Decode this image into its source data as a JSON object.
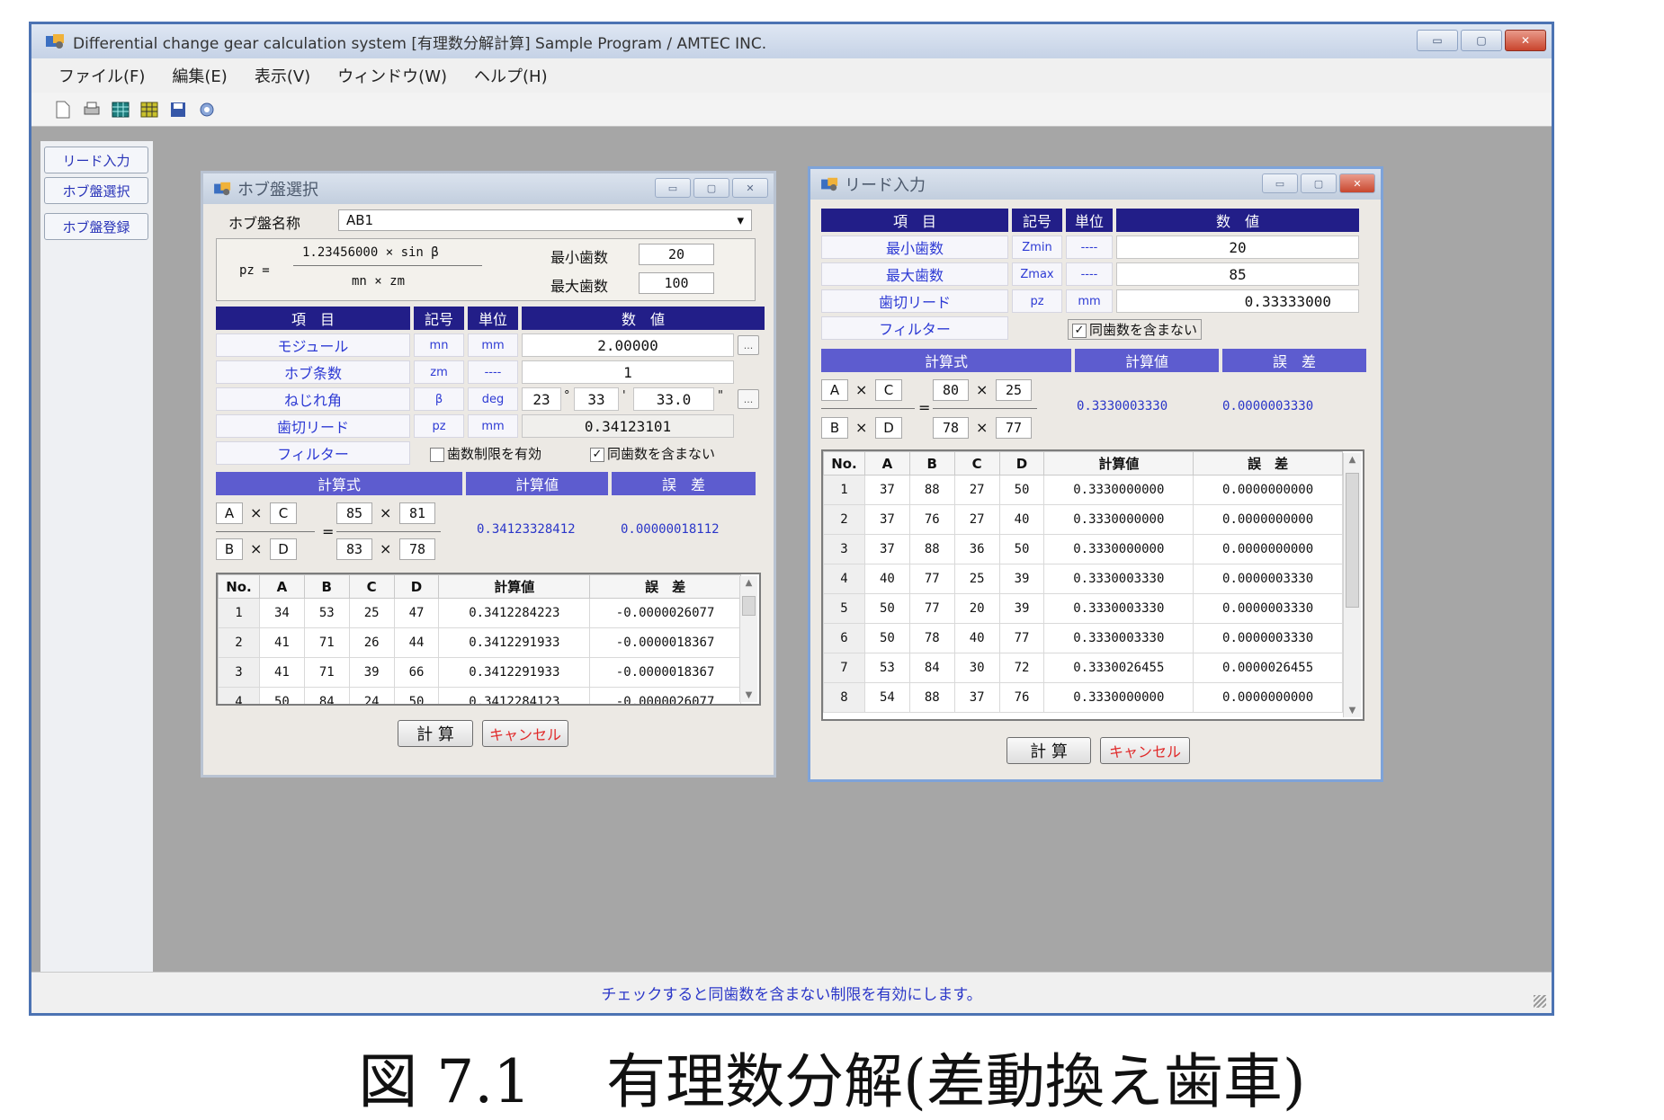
{
  "window": {
    "title": "Differential change gear calculation system [有理数分解計算]  Sample Program / AMTEC INC.",
    "minimize": "▭",
    "maximize": "▢",
    "close": "✕"
  },
  "menu": [
    "ファイル(F)",
    "編集(E)",
    "表示(V)",
    "ウィンドウ(W)",
    "ヘルプ(H)"
  ],
  "toolbar_icons": [
    "new-file-icon",
    "print-icon",
    "grid-icon",
    "table-icon",
    "save-icon",
    "tool-icon"
  ],
  "sidebar": [
    "リード入力",
    "ホブ盤選択",
    "ホブ盤登録"
  ],
  "status": "チェックすると同歯数を含まない制限を有効にします。",
  "caption": "図 7.1    有理数分解(差動換え歯車)",
  "hob": {
    "title": "ホブ盤選択",
    "machine_label": "ホブ盤名称",
    "machine_value": "AB1",
    "dropdown": "▾",
    "formula_pz": "pz =",
    "formula_num": "1.23456000 × sin β",
    "formula_den": "mn × zm",
    "min_label": "最小歯数",
    "min_value": "20",
    "max_label": "最大歯数",
    "max_value": "100",
    "headers": [
      "項　目",
      "記号",
      "単位",
      "数　値"
    ],
    "rows": [
      {
        "label": "モジュール",
        "sym": "mn",
        "unit": "mm",
        "value": "2.00000"
      },
      {
        "label": "ホブ条数",
        "sym": "zm",
        "unit": "----",
        "value": "1"
      },
      {
        "label": "ねじれ角",
        "sym": "β",
        "unit": "deg",
        "v1": "23",
        "v2": "33",
        "v3": "33.0"
      },
      {
        "label": "歯切リード",
        "sym": "pz",
        "unit": "mm",
        "value": "0.34123101"
      },
      {
        "label": "フィルター",
        "chk1": "歯数制限を有効",
        "chk2": "同歯数を含まない"
      }
    ],
    "deg_mark": "°",
    "min_mark": "'",
    "sec_mark": "\"",
    "dots": "...",
    "check": "✓",
    "res_headers": [
      "計算式",
      "計算値",
      "誤　差"
    ],
    "fA": "A",
    "fC": "C",
    "fB": "B",
    "fD": "D",
    "times": "×",
    "eq": "=",
    "vA": "85",
    "vC": "81",
    "vB": "83",
    "vD": "78",
    "result": "0.34123328412",
    "error": "0.00000018112",
    "list_headers": [
      "No.",
      "A",
      "B",
      "C",
      "D",
      "計算値",
      "誤　差"
    ],
    "list": [
      [
        "1",
        "34",
        "53",
        "25",
        "47",
        "0.3412284223",
        "-0.0000026077"
      ],
      [
        "2",
        "41",
        "71",
        "26",
        "44",
        "0.3412291933",
        "-0.0000018367"
      ],
      [
        "3",
        "41",
        "71",
        "39",
        "66",
        "0.3412291933",
        "-0.0000018367"
      ],
      [
        "4",
        "50",
        "84",
        "24",
        "50",
        "0.3412284123",
        "-0.0000026077"
      ]
    ],
    "calc": "計 算",
    "cancel": "キャンセル"
  },
  "lead": {
    "title": "リード入力",
    "headers": [
      "項　目",
      "記号",
      "単位",
      "数　値"
    ],
    "rows": [
      {
        "label": "最小歯数",
        "sym": "Zmin",
        "unit": "----",
        "value": "20"
      },
      {
        "label": "最大歯数",
        "sym": "Zmax",
        "unit": "----",
        "value": "85"
      },
      {
        "label": "歯切リード",
        "sym": "pz",
        "unit": "mm",
        "value": "0.33333000"
      },
      {
        "label": "フィルター",
        "chk": "同歯数を含まない"
      }
    ],
    "check": "✓",
    "res_headers": [
      "計算式",
      "計算値",
      "誤　差"
    ],
    "fA": "A",
    "fC": "C",
    "fB": "B",
    "fD": "D",
    "times": "×",
    "eq": "=",
    "vA": "80",
    "vC": "25",
    "vB": "78",
    "vD": "77",
    "result": "0.3330003330",
    "error": "0.0000003330",
    "list_headers": [
      "No.",
      "A",
      "B",
      "C",
      "D",
      "計算値",
      "誤　差"
    ],
    "list": [
      [
        "1",
        "37",
        "88",
        "27",
        "50",
        "0.3330000000",
        "0.0000000000"
      ],
      [
        "2",
        "37",
        "76",
        "27",
        "40",
        "0.3330000000",
        "0.0000000000"
      ],
      [
        "3",
        "37",
        "88",
        "36",
        "50",
        "0.3330000000",
        "0.0000000000"
      ],
      [
        "4",
        "40",
        "77",
        "25",
        "39",
        "0.3330003330",
        "0.0000003330"
      ],
      [
        "5",
        "50",
        "77",
        "20",
        "39",
        "0.3330003330",
        "0.0000003330"
      ],
      [
        "6",
        "50",
        "78",
        "40",
        "77",
        "0.3330003330",
        "0.0000003330"
      ],
      [
        "7",
        "53",
        "84",
        "30",
        "72",
        "0.3330026455",
        "0.0000026455"
      ],
      [
        "8",
        "54",
        "88",
        "37",
        "76",
        "0.3330000000",
        "0.0000000000"
      ]
    ],
    "calc": "計 算",
    "cancel": "キャンセル"
  }
}
